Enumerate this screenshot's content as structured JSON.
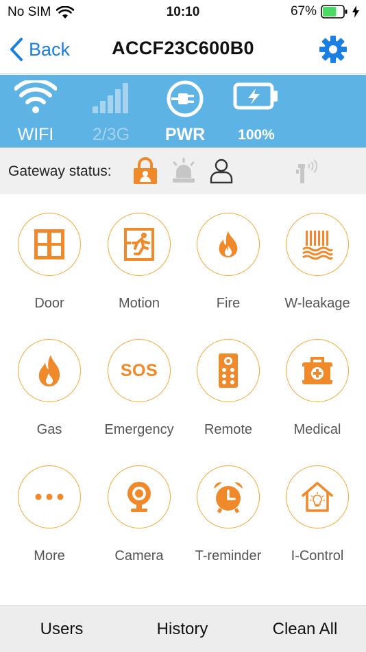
{
  "status_bar": {
    "carrier": "No SIM",
    "time": "10:10",
    "battery_percent": "67%",
    "battery_level": 0.67
  },
  "nav": {
    "back_label": "Back",
    "title": "ACCF23C600B0"
  },
  "status_strip": {
    "wifi_label": "WIFI",
    "cellular_label": "2/3G",
    "power_label": "PWR",
    "battery_label": "100%"
  },
  "gateway": {
    "label": "Gateway status:"
  },
  "tiles": [
    {
      "label": "Door",
      "icon": "door-icon"
    },
    {
      "label": "Motion",
      "icon": "motion-icon"
    },
    {
      "label": "Fire",
      "icon": "fire-icon"
    },
    {
      "label": "W-leakage",
      "icon": "water-leakage-icon"
    },
    {
      "label": "Gas",
      "icon": "gas-icon"
    },
    {
      "label": "Emergency",
      "icon": "sos-icon",
      "icon_text": "SOS"
    },
    {
      "label": "Remote",
      "icon": "remote-icon"
    },
    {
      "label": "Medical",
      "icon": "medical-icon"
    },
    {
      "label": "More",
      "icon": "more-icon"
    },
    {
      "label": "Camera",
      "icon": "camera-icon"
    },
    {
      "label": "T-reminder",
      "icon": "alarm-clock-icon"
    },
    {
      "label": "I-Control",
      "icon": "smart-home-icon"
    }
  ],
  "bottom_bar": {
    "users_label": "Users",
    "history_label": "History",
    "clean_all_label": "Clean All"
  },
  "colors": {
    "accent_orange": "#f2a732",
    "icon_orange": "#f0892a",
    "strip_blue": "#5cb3e4",
    "link_blue": "#1a7fe0",
    "battery_green": "#4cd964"
  }
}
